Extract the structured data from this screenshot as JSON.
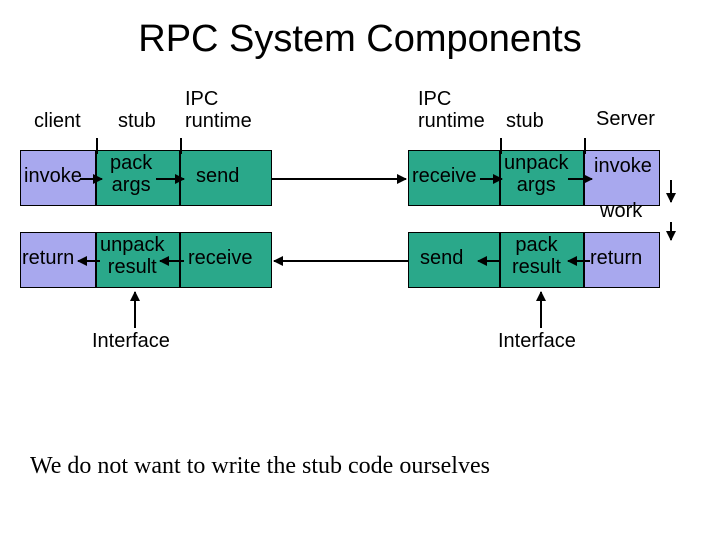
{
  "title": "RPC System Components",
  "left": {
    "col_client": "client",
    "col_stub": "stub",
    "col_ipc": "IPC\nruntime",
    "invoke": "invoke",
    "pack_args": "pack\nargs",
    "send": "send",
    "return": "return",
    "unpack_result": "unpack\nresult",
    "receive": "receive",
    "interface": "Interface"
  },
  "right": {
    "col_ipc": "IPC\nruntime",
    "col_stub": "stub",
    "col_server": "Server",
    "receive": "receive",
    "unpack_args": "unpack\nargs",
    "invoke": "invoke",
    "work": "work",
    "send": "send",
    "pack_result": "pack\nresult",
    "return": "return",
    "interface": "Interface"
  },
  "caption": "We do not want to write the stub code ourselves"
}
